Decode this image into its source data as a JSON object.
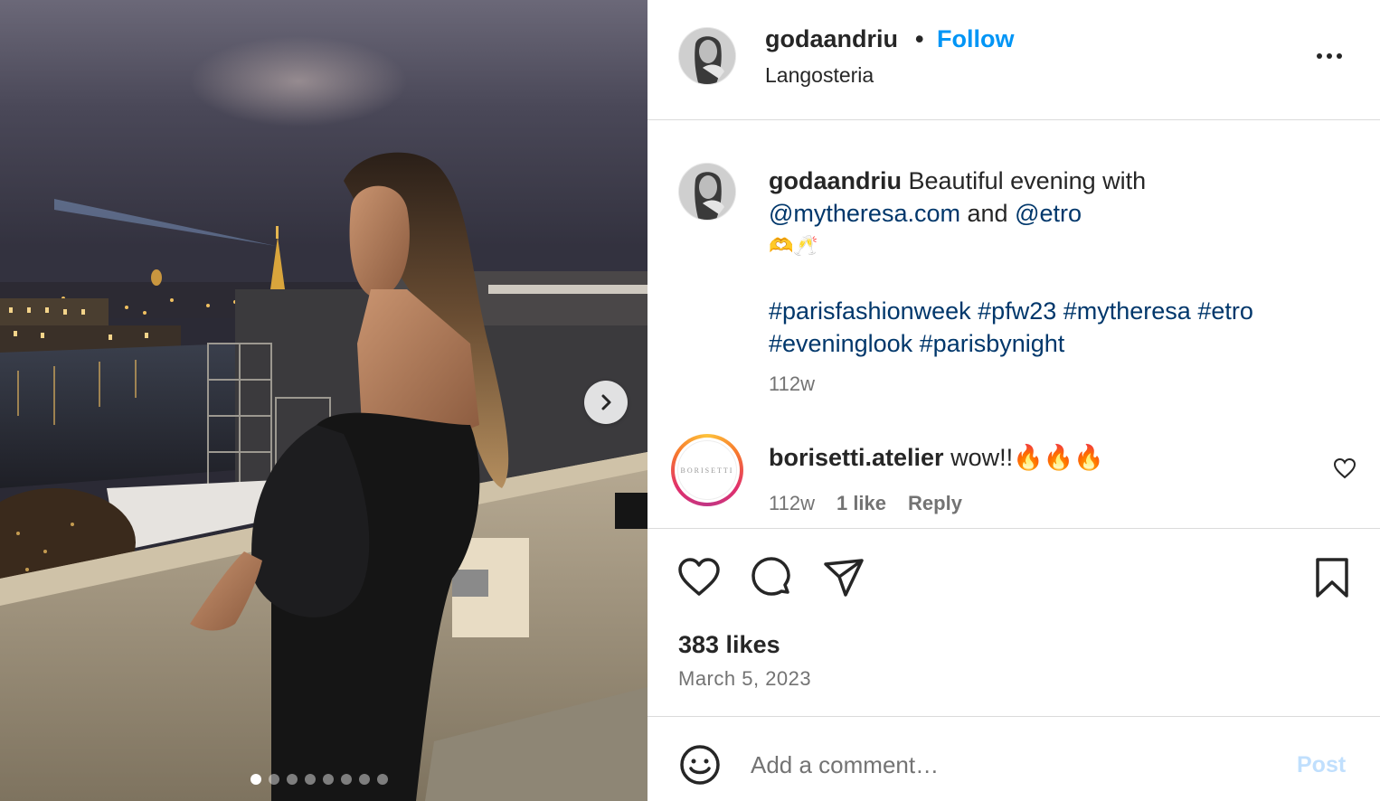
{
  "post": {
    "username": "godaandriu",
    "separator": "•",
    "follow_label": "Follow",
    "location": "Langosteria",
    "more_icon": "more-horizontal-icon"
  },
  "caption": {
    "username": "godaandriu",
    "text_1": "Beautiful evening with",
    "mention_1": "@mytheresa.com",
    "and_word": "and",
    "mention_2": "@etro",
    "emojis": "🫶🥂",
    "hashtags_line_1": [
      "#parisfashionweek",
      "#pfw23",
      "#mytheresa",
      "#etro"
    ],
    "hashtags_line_2": [
      "#eveninglook",
      "#parisbynight"
    ],
    "time": "112w"
  },
  "comments": [
    {
      "username": "borisetti.atelier",
      "text": "wow!!🔥🔥🔥",
      "avatar_text": "BORISETTI",
      "time": "112w",
      "likes_label": "1 like",
      "reply_label": "Reply"
    }
  ],
  "actions": {
    "like_icon": "heart-icon",
    "comment_icon": "comment-icon",
    "share_icon": "send-icon",
    "save_icon": "bookmark-icon"
  },
  "stats": {
    "likes": "383 likes",
    "date": "March 5, 2023"
  },
  "composer": {
    "placeholder": "Add a comment…",
    "post_label": "Post"
  },
  "carousel": {
    "total_slides": 8,
    "active_index": 0
  },
  "colors": {
    "link_blue": "#0095f6",
    "mention_navy": "#00376b",
    "secondary_text": "#737373",
    "divider": "#dbdbdb"
  }
}
